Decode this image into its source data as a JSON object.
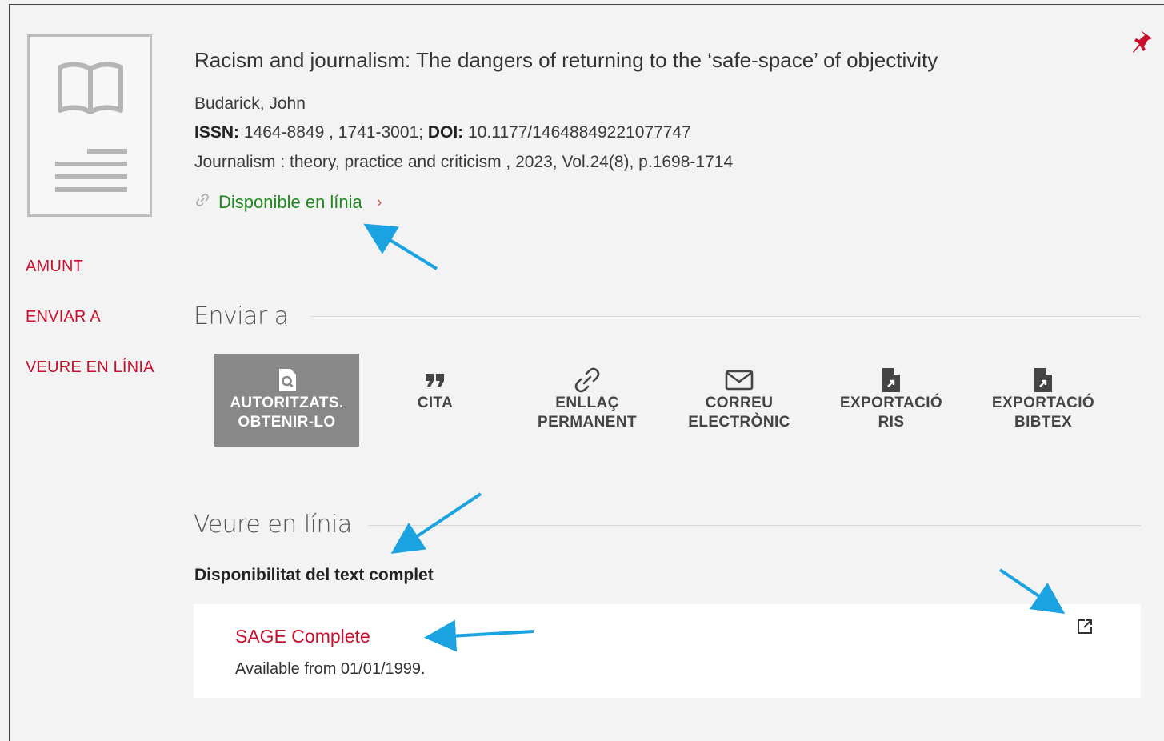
{
  "record": {
    "title": "Racism and journalism: The dangers of returning to the ‘safe-space’ of objectivity",
    "author": "Budarick, John",
    "issn_label": "ISSN:",
    "issn_value": " 1464-8849 , 1741-3001; ",
    "doi_label": "DOI:",
    "doi_value": " 10.1177/14648849221077747",
    "source": "Journalism : theory, practice and criticism , 2023, Vol.24(8), p.1698-1714",
    "availability": "Disponible en línia"
  },
  "sidebar": {
    "items": [
      {
        "label": "AMUNT"
      },
      {
        "label": "ENVIAR A"
      },
      {
        "label": "VEURE EN LÍNIA"
      }
    ]
  },
  "send_to": {
    "title": "Enviar a",
    "actions": [
      {
        "label": "AUTORITZATS.\nOBTENIR-LO",
        "icon": "search-document-icon"
      },
      {
        "label": "CITA",
        "icon": "quote-icon"
      },
      {
        "label": "ENLLAÇ\nPERMANENT",
        "icon": "link-icon"
      },
      {
        "label": "CORREU\nELECTRÒNIC",
        "icon": "mail-icon"
      },
      {
        "label": "EXPORTACIÓ\nRIS",
        "icon": "file-export-icon"
      },
      {
        "label": "EXPORTACIÓ\nBIBTEX",
        "icon": "file-export-icon"
      }
    ]
  },
  "online": {
    "title": "Veure en línia",
    "fulltext_heading": "Disponibilitat del text complet",
    "provider": "SAGE Complete",
    "coverage": "Available from 01/01/1999."
  },
  "colors": {
    "accent_red": "#c8102e",
    "available_green": "#1f8a1f",
    "annotation_blue": "#1aa3e0"
  }
}
